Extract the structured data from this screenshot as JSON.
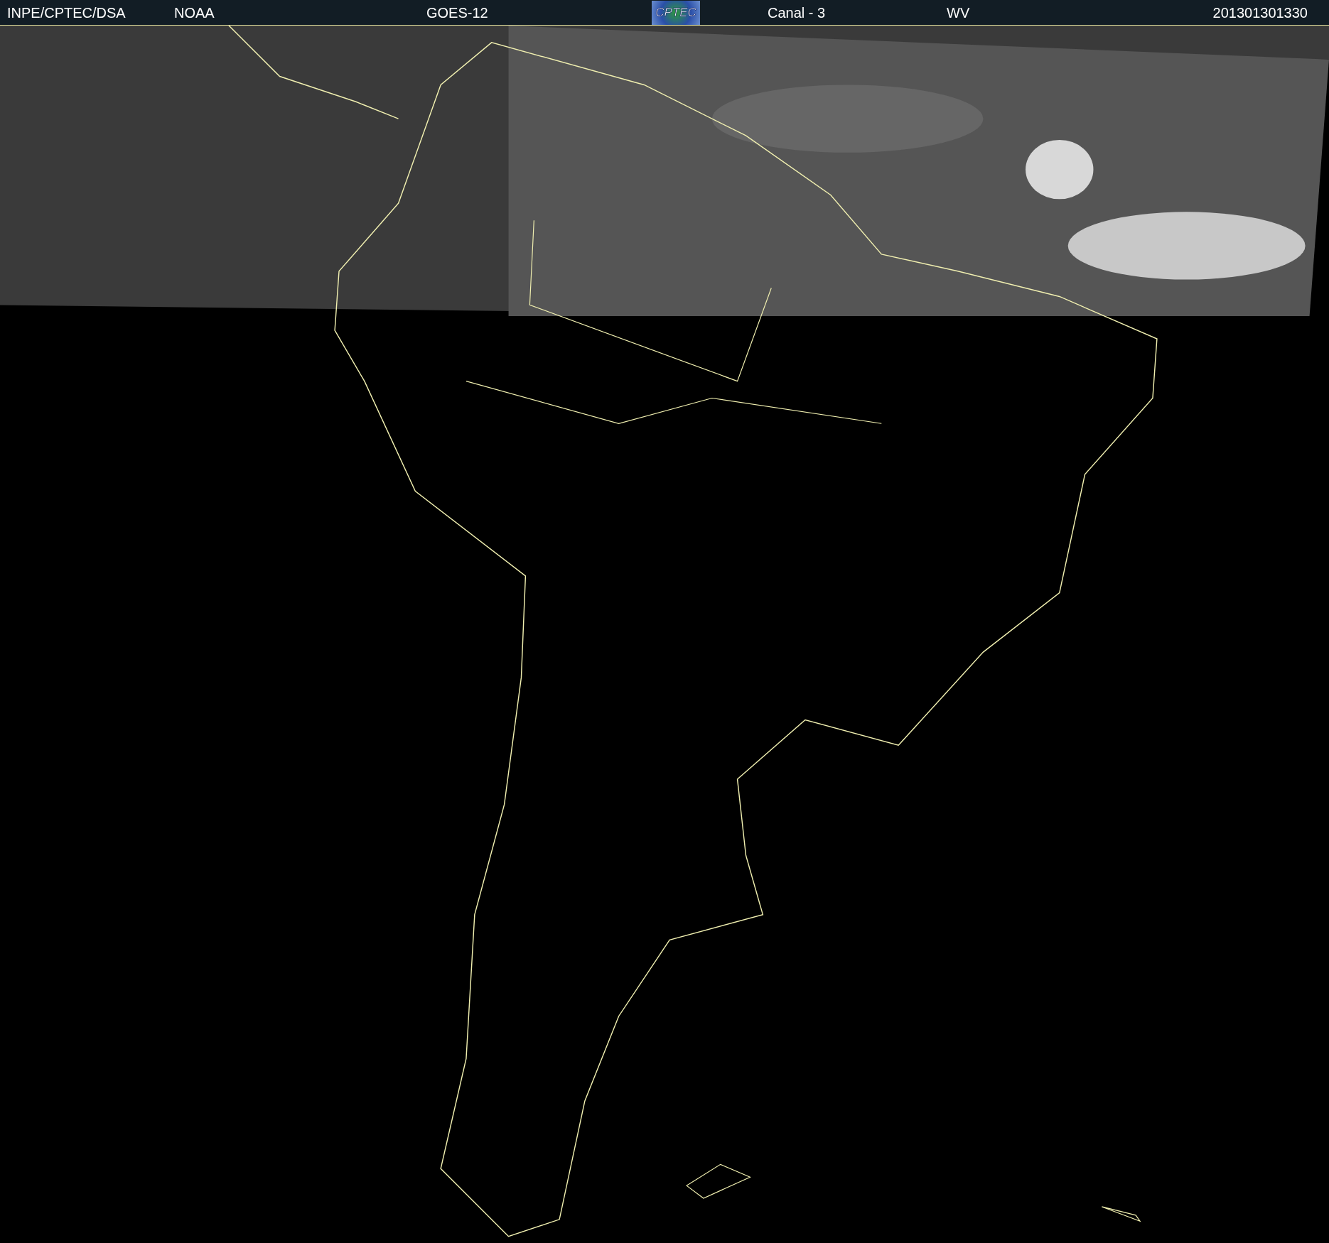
{
  "header": {
    "items": [
      {
        "kind": "text",
        "text": "INPE/CPTEC/DSA"
      },
      {
        "kind": "text",
        "text": "NOAA"
      },
      {
        "kind": "text",
        "text": "GOES-12"
      },
      {
        "kind": "logo",
        "text": "CPTEC"
      },
      {
        "kind": "text",
        "text": "Canal - 3"
      },
      {
        "kind": "text",
        "text": "WV"
      },
      {
        "kind": "text",
        "text": "201301301330"
      }
    ]
  }
}
